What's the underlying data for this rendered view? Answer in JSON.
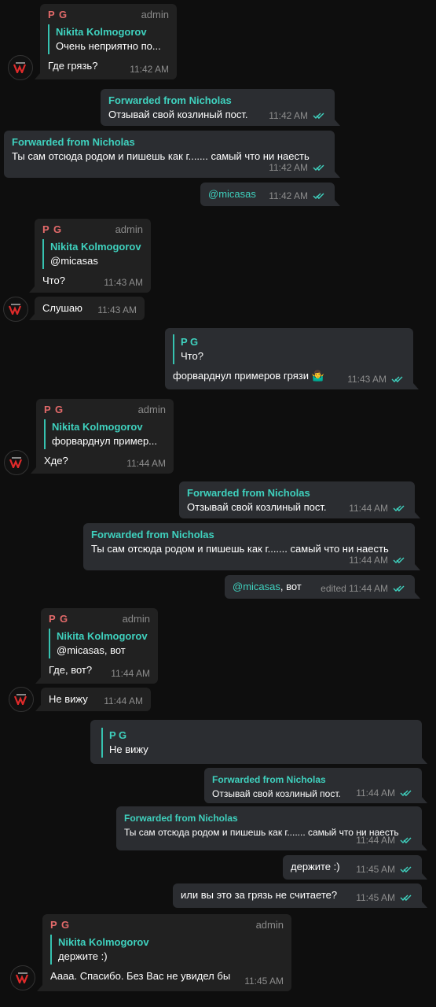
{
  "colors": {
    "accent": "#3fd1be",
    "sender": "#e36a6a",
    "bubble_in": "#212121",
    "bubble_out": "#2b2d31",
    "bg": "#0e0e0e"
  },
  "icons": {
    "read": "double-check-icon",
    "avatar": "avatar-logo-icon"
  },
  "messages": [
    {
      "sender": "P G",
      "role": "admin",
      "reply_name": "Nikita Kolmogorov",
      "reply_text": "Очень неприятно по...",
      "text": "Где грязь?",
      "time": "11:42 AM"
    },
    {
      "fwd": "Forwarded from Nicholas",
      "text": "Отзывай свой козлиный пост.",
      "time": "11:42 AM"
    },
    {
      "fwd": "Forwarded from Nicholas",
      "text": "Ты сам отсюда родом и пишешь как г....... самый что ни наесть",
      "time": "11:42 AM"
    },
    {
      "mention": "@micasas",
      "time": "11:42 AM"
    },
    {
      "sender": "P G",
      "role": "admin",
      "reply_name": "Nikita Kolmogorov",
      "reply_text": "@micasas",
      "text": "Что?",
      "time": "11:43 AM"
    },
    {
      "text": "Слушаю",
      "time": "11:43 AM"
    },
    {
      "reply_name": "P G",
      "reply_text": "Что?",
      "text": "форварднул примеров грязи 🤷‍♂️",
      "time": "11:43 AM"
    },
    {
      "sender": "P G",
      "role": "admin",
      "reply_name": "Nikita Kolmogorov",
      "reply_text": "форварднул пример...",
      "text": "Хде?",
      "time": "11:44 AM"
    },
    {
      "fwd": "Forwarded from Nicholas",
      "text": "Отзывай свой козлиный пост.",
      "time": "11:44 AM"
    },
    {
      "fwd": "Forwarded from Nicholas",
      "text": "Ты сам отсюда родом и пишешь как г....... самый что ни наесть",
      "time": "11:44 AM"
    },
    {
      "mention": "@micasas",
      "text": ", вот",
      "time": "edited 11:44 AM"
    },
    {
      "sender": "P G",
      "role": "admin",
      "reply_name": "Nikita Kolmogorov",
      "reply_text": "@micasas, вот",
      "text": "Где, вот?",
      "time": "11:44 AM"
    },
    {
      "text": "Не вижу",
      "time": "11:44 AM"
    },
    {
      "reply_name": "P G",
      "reply_text": "Не вижу"
    },
    {
      "fwd": "Forwarded from Nicholas",
      "text": "Отзывай свой козлиный пост.",
      "time": "11:44 AM"
    },
    {
      "fwd": "Forwarded from Nicholas",
      "text": "Ты сам отсюда родом и пишешь как г....... самый что ни наесть",
      "time": "11:44 AM"
    },
    {
      "text": "держите :)",
      "time": "11:45 AM"
    },
    {
      "text": "или вы это за грязь не считаете?",
      "time": "11:45 AM"
    },
    {
      "sender": "P G",
      "role": "admin",
      "reply_name": "Nikita Kolmogorov",
      "reply_text": "держите :)",
      "text": "Аааа. Спасибо. Без Вас не увидел бы",
      "time": "11:45 AM"
    }
  ]
}
